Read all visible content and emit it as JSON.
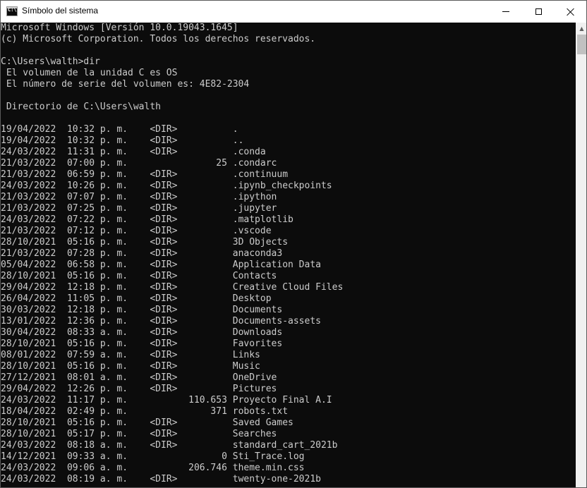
{
  "window": {
    "title": "Símbolo del sistema",
    "icon": "cmd-icon",
    "icon_text": "C:\\"
  },
  "header_lines": [
    "Microsoft Windows [Versión 10.0.19043.1645]",
    "(c) Microsoft Corporation. Todos los derechos reservados.",
    "",
    "C:\\Users\\walth>dir",
    " El volumen de la unidad C es OS",
    " El número de serie del volumen es: 4E82-2304",
    "",
    " Directorio de C:\\Users\\walth",
    ""
  ],
  "entries": [
    {
      "date": "19/04/2022",
      "time": "10:32 p. m.",
      "type": "<DIR>",
      "size": "",
      "name": "."
    },
    {
      "date": "19/04/2022",
      "time": "10:32 p. m.",
      "type": "<DIR>",
      "size": "",
      "name": ".."
    },
    {
      "date": "24/03/2022",
      "time": "11:31 p. m.",
      "type": "<DIR>",
      "size": "",
      "name": ".conda"
    },
    {
      "date": "21/03/2022",
      "time": "07:00 p. m.",
      "type": "",
      "size": "25",
      "name": ".condarc"
    },
    {
      "date": "21/03/2022",
      "time": "06:59 p. m.",
      "type": "<DIR>",
      "size": "",
      "name": ".continuum"
    },
    {
      "date": "24/03/2022",
      "time": "10:26 p. m.",
      "type": "<DIR>",
      "size": "",
      "name": ".ipynb_checkpoints"
    },
    {
      "date": "21/03/2022",
      "time": "07:07 p. m.",
      "type": "<DIR>",
      "size": "",
      "name": ".ipython"
    },
    {
      "date": "21/03/2022",
      "time": "07:25 p. m.",
      "type": "<DIR>",
      "size": "",
      "name": ".jupyter"
    },
    {
      "date": "24/03/2022",
      "time": "07:22 p. m.",
      "type": "<DIR>",
      "size": "",
      "name": ".matplotlib"
    },
    {
      "date": "21/03/2022",
      "time": "07:12 p. m.",
      "type": "<DIR>",
      "size": "",
      "name": ".vscode"
    },
    {
      "date": "28/10/2021",
      "time": "05:16 p. m.",
      "type": "<DIR>",
      "size": "",
      "name": "3D Objects"
    },
    {
      "date": "21/03/2022",
      "time": "07:28 p. m.",
      "type": "<DIR>",
      "size": "",
      "name": "anaconda3"
    },
    {
      "date": "05/04/2022",
      "time": "06:58 p. m.",
      "type": "<DIR>",
      "size": "",
      "name": "Application Data"
    },
    {
      "date": "28/10/2021",
      "time": "05:16 p. m.",
      "type": "<DIR>",
      "size": "",
      "name": "Contacts"
    },
    {
      "date": "29/04/2022",
      "time": "12:18 p. m.",
      "type": "<DIR>",
      "size": "",
      "name": "Creative Cloud Files"
    },
    {
      "date": "26/04/2022",
      "time": "11:05 p. m.",
      "type": "<DIR>",
      "size": "",
      "name": "Desktop"
    },
    {
      "date": "30/03/2022",
      "time": "12:18 p. m.",
      "type": "<DIR>",
      "size": "",
      "name": "Documents"
    },
    {
      "date": "13/01/2022",
      "time": "12:36 p. m.",
      "type": "<DIR>",
      "size": "",
      "name": "Documents-assets"
    },
    {
      "date": "30/04/2022",
      "time": "08:33 a. m.",
      "type": "<DIR>",
      "size": "",
      "name": "Downloads"
    },
    {
      "date": "28/10/2021",
      "time": "05:16 p. m.",
      "type": "<DIR>",
      "size": "",
      "name": "Favorites"
    },
    {
      "date": "08/01/2022",
      "time": "07:59 a. m.",
      "type": "<DIR>",
      "size": "",
      "name": "Links"
    },
    {
      "date": "28/10/2021",
      "time": "05:16 p. m.",
      "type": "<DIR>",
      "size": "",
      "name": "Music"
    },
    {
      "date": "27/12/2021",
      "time": "08:01 a. m.",
      "type": "<DIR>",
      "size": "",
      "name": "OneDrive"
    },
    {
      "date": "29/04/2022",
      "time": "12:26 p. m.",
      "type": "<DIR>",
      "size": "",
      "name": "Pictures"
    },
    {
      "date": "24/03/2022",
      "time": "11:17 p. m.",
      "type": "",
      "size": "110.653",
      "name": "Proyecto Final A.I"
    },
    {
      "date": "18/04/2022",
      "time": "02:49 p. m.",
      "type": "",
      "size": "371",
      "name": "robots.txt"
    },
    {
      "date": "28/10/2021",
      "time": "05:16 p. m.",
      "type": "<DIR>",
      "size": "",
      "name": "Saved Games"
    },
    {
      "date": "28/10/2021",
      "time": "05:17 p. m.",
      "type": "<DIR>",
      "size": "",
      "name": "Searches"
    },
    {
      "date": "24/03/2022",
      "time": "08:18 a. m.",
      "type": "<DIR>",
      "size": "",
      "name": "standard_cart_2021b"
    },
    {
      "date": "14/12/2021",
      "time": "09:33 a. m.",
      "type": "",
      "size": "0",
      "name": "Sti_Trace.log"
    },
    {
      "date": "24/03/2022",
      "time": "09:06 a. m.",
      "type": "",
      "size": "206.746",
      "name": "theme.min.css"
    },
    {
      "date": "24/03/2022",
      "time": "08:19 a. m.",
      "type": "<DIR>",
      "size": "",
      "name": "twenty-one-2021b"
    }
  ],
  "colors": {
    "console_bg": "#0c0c0c",
    "console_fg": "#cccccc",
    "titlebar_bg": "#ffffff"
  }
}
